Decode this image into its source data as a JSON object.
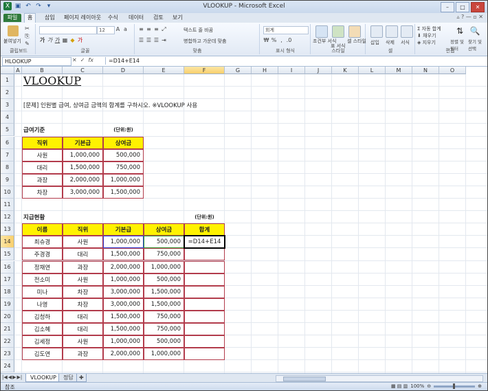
{
  "window": {
    "title": "VLOOKUP - Microsoft Excel"
  },
  "ribbon_tabs": [
    "파일",
    "홈",
    "삽입",
    "페이지 레이아웃",
    "수식",
    "데이터",
    "검토",
    "보기"
  ],
  "ribbon": {
    "clipboard": {
      "paste": "붙여넣기",
      "label": "클립보드"
    },
    "font": {
      "size": "12",
      "label": "글꼴"
    },
    "alignment": {
      "wrap": "텍스트 줄 바꿈",
      "merge": "병합하고 가운데 맞춤",
      "label": "맞춤"
    },
    "number": {
      "format": "회계",
      "label": "표시 형식"
    },
    "styles": {
      "cond": "조건부 서식",
      "table": "표 서식",
      "cell": "셀 스타일",
      "label": "스타일"
    },
    "cells": {
      "insert": "삽입",
      "delete": "삭제",
      "format": "서식",
      "label": "셀"
    },
    "editing": {
      "autosum": "자동 합계",
      "fill": "채우기",
      "clear": "지우기",
      "sort": "정렬 및 필터",
      "find": "찾기 및 선택",
      "label": "편집"
    }
  },
  "formula_bar": {
    "name_box": "HLOOKUP",
    "formula": "=D14+E14"
  },
  "columns": [
    "A",
    "B",
    "C",
    "D",
    "E",
    "F",
    "G",
    "H",
    "I",
    "J",
    "K",
    "L",
    "M",
    "N",
    "O"
  ],
  "rows": [
    "1",
    "2",
    "3",
    "4",
    "5",
    "6",
    "7",
    "8",
    "9",
    "10",
    "11",
    "12",
    "13",
    "14",
    "15",
    "16",
    "17",
    "18",
    "19",
    "20",
    "21",
    "22",
    "23",
    "24"
  ],
  "sheet": {
    "title": "VLOOKUP",
    "problem": "[문제] 인원별 급여, 상여금 금액의 합계를 구하시오. ※VLOOKUP 사용",
    "table1_title": "급여기준",
    "table1_unit": "(단위:원)",
    "table1_headers": [
      "직위",
      "기본급",
      "상여금"
    ],
    "table1_rows": [
      [
        "사원",
        "1,000,000",
        "500,000"
      ],
      [
        "대리",
        "1,500,000",
        "750,000"
      ],
      [
        "과장",
        "2,000,000",
        "1,000,000"
      ],
      [
        "차장",
        "3,000,000",
        "1,500,000"
      ]
    ],
    "table2_title": "지급현황",
    "table2_unit": "(단위:원)",
    "table2_headers": [
      "이름",
      "직위",
      "기본급",
      "상여금",
      "합계"
    ],
    "table2_rows": [
      [
        "최슈경",
        "사원",
        "1,000,000",
        "500,000",
        "=D14+E14"
      ],
      [
        "주경경",
        "대리",
        "1,500,000",
        "750,000",
        ""
      ],
      [
        "정채연",
        "과장",
        "2,000,000",
        "1,000,000",
        ""
      ],
      [
        "전소미",
        "사원",
        "1,000,000",
        "500,000",
        ""
      ],
      [
        "미나",
        "차장",
        "3,000,000",
        "1,500,000",
        ""
      ],
      [
        "나영",
        "차장",
        "3,000,000",
        "1,500,000",
        ""
      ],
      [
        "김청하",
        "대리",
        "1,500,000",
        "750,000",
        ""
      ],
      [
        "김소혜",
        "대리",
        "1,500,000",
        "750,000",
        ""
      ],
      [
        "김세정",
        "사원",
        "1,000,000",
        "500,000",
        ""
      ],
      [
        "김도연",
        "과장",
        "2,000,000",
        "1,000,000",
        ""
      ]
    ]
  },
  "sheet_tabs": [
    "VLOOKUP",
    "정답"
  ],
  "status": {
    "mode": "참조",
    "zoom": "100%"
  }
}
